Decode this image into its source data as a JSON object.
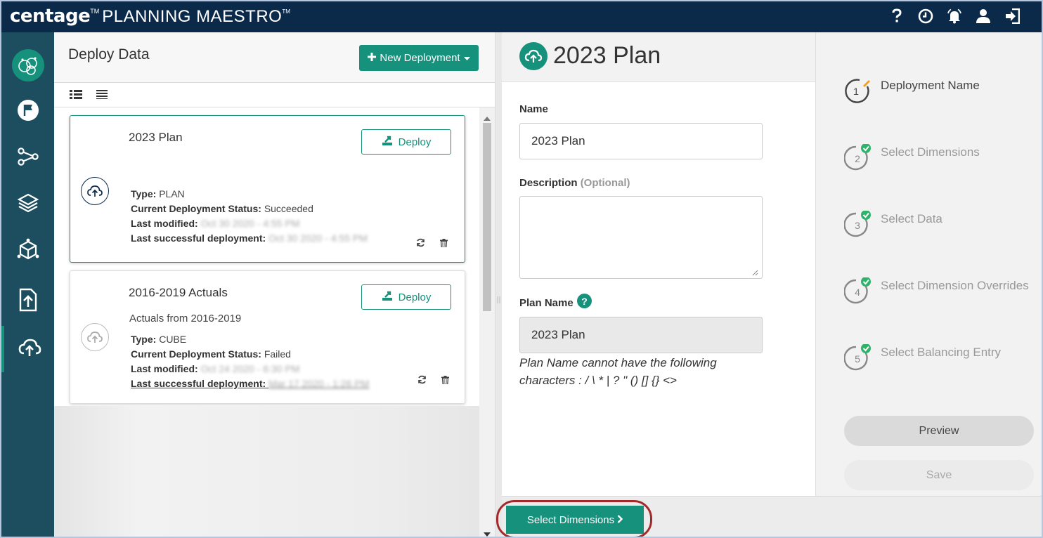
{
  "app": {
    "brand_main": "centage",
    "brand_tm": "TM",
    "brand_product": "PLANNING MAESTRO",
    "brand_tm2": "TM"
  },
  "top_icons": [
    "help-icon",
    "clock-icon",
    "bell-icon",
    "user-icon",
    "logout-icon"
  ],
  "nav": [
    "logo-icon",
    "flag-icon",
    "flow-icon",
    "layers-icon",
    "cube-icon",
    "upload-icon",
    "cloud-upload-icon"
  ],
  "deploy": {
    "title": "Deploy Data",
    "new_button": "New Deployment",
    "cards": [
      {
        "name": "2023 Plan",
        "description": "",
        "deploy_label": "Deploy",
        "type_label": "Type:",
        "type": "PLAN",
        "status_label": "Current Deployment Status:",
        "status": "Succeeded",
        "modified_label": "Last modified:",
        "modified": "Oct 30 2020 - 4:55 PM",
        "last_success_label": "Last successful deployment:",
        "last_success": "Oct 30 2020 - 4:55 PM"
      },
      {
        "name": "2016-2019 Actuals",
        "description": "Actuals from 2016-2019",
        "deploy_label": "Deploy",
        "type_label": "Type:",
        "type": "CUBE",
        "status_label": "Current Deployment Status:",
        "status": "Failed",
        "modified_label": "Last modified:",
        "modified": "Oct 24 2020 - 6:30 PM",
        "last_success_label": "Last successful deployment:",
        "last_success": "Mar 17 2020 - 1:26 PM"
      }
    ]
  },
  "form": {
    "title": "2023 Plan",
    "name_label": "Name",
    "name_value": "2023 Plan",
    "description_label": "Description",
    "description_optional": "(Optional)",
    "description_value": "",
    "plan_name_label": "Plan Name",
    "help_glyph": "?",
    "plan_name_value": "2023 Plan",
    "hint": "Plan Name cannot have the following characters : / \\ * | ? \" () [] {} <>"
  },
  "steps": [
    {
      "num": "1",
      "label": "Deployment Name",
      "state": "current"
    },
    {
      "num": "2",
      "label": "Select Dimensions",
      "state": "done"
    },
    {
      "num": "3",
      "label": "Select Data",
      "state": "done"
    },
    {
      "num": "4",
      "label": "Select Dimension Overrides",
      "state": "done"
    },
    {
      "num": "5",
      "label": "Select Balancing Entry",
      "state": "done"
    }
  ],
  "actions": {
    "preview": "Preview",
    "save": "Save",
    "next": "Select Dimensions"
  },
  "colors": {
    "primary": "#16917c",
    "topbar": "#0b2a4a",
    "sidebar": "#1d4e5f",
    "highlight": "#a32a2a"
  }
}
